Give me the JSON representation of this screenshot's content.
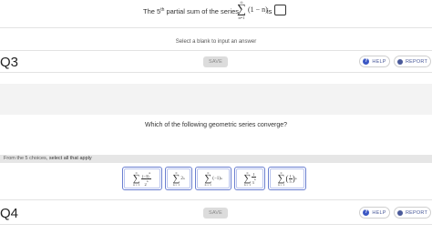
{
  "q2": {
    "prompt_prefix": "The 5",
    "prompt_sup": "th",
    "prompt_mid": " partial sum of the series",
    "sum_top": "∞",
    "sum_symbol": "∑",
    "sum_bottom": "n=1",
    "summand": "(1 − n)",
    "is_label": "is",
    "hint": "Select a blank to input an answer"
  },
  "q3": {
    "number": "Q3",
    "save_label": "SAVE",
    "help_label": "HELP",
    "report_label": "REPORT",
    "question": "Which of the following geometric series converge?",
    "instruction_prefix": "From the 5 choices, ",
    "instruction_bold": "select all that apply",
    "choices": [
      {
        "num": "(−3)",
        "num_sup": "n",
        "den": "2",
        "den_sup": "n"
      },
      {
        "base": "2",
        "exp": "n"
      },
      {
        "base": "(−1)",
        "exp": "n"
      },
      {
        "num": "1",
        "den": "3",
        "den_sup": "n"
      },
      {
        "num": "1",
        "den": "5",
        "exp": "n"
      }
    ],
    "sum_symbol": "∑",
    "sum_top": "∞",
    "sum_bottom": "n = 1"
  },
  "q4": {
    "number": "Q4",
    "save_label": "SAVE",
    "help_label": "HELP",
    "report_label": "REPORT"
  },
  "colors": {
    "accent": "#3b57c4",
    "choice_border": "#6a7fd0",
    "save_bg": "#dcdcdc"
  }
}
